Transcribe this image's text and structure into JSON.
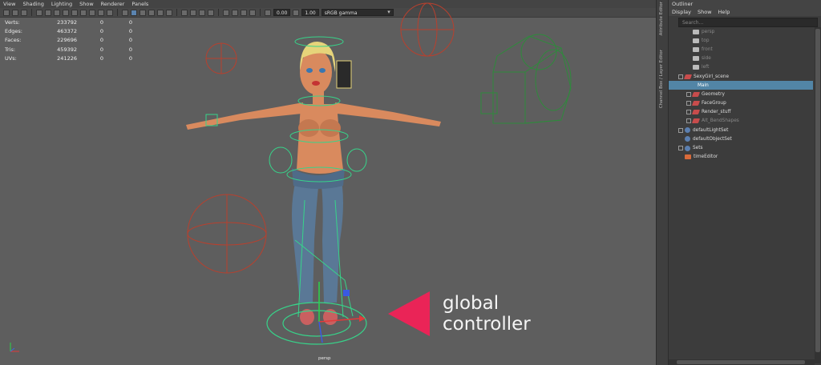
{
  "viewport": {
    "menu": [
      "View",
      "Shading",
      "Lighting",
      "Show",
      "Renderer",
      "Panels"
    ],
    "toolbar": {
      "exposure": "0.00",
      "gamma": "1.00",
      "color_space": "sRGB gamma"
    },
    "hud": [
      {
        "label": "Verts:",
        "values": [
          "233792",
          "0",
          "0"
        ]
      },
      {
        "label": "Edges:",
        "values": [
          "463372",
          "0",
          "0"
        ]
      },
      {
        "label": "Faces:",
        "values": [
          "229696",
          "0",
          "0"
        ]
      },
      {
        "label": "Tris:",
        "values": [
          "459392",
          "0",
          "0"
        ]
      },
      {
        "label": "UVs:",
        "values": [
          "241226",
          "0",
          "0"
        ]
      }
    ],
    "camera_label": "persp",
    "callout": {
      "line1": "global",
      "line2": "controller",
      "color": "#ea2457"
    }
  },
  "side_tabs": [
    "Attribute Editor",
    "Channel Box / Layer Editor"
  ],
  "outliner": {
    "title": "Outliner",
    "menu": [
      "Display",
      "Show",
      "Help"
    ],
    "search_placeholder": "Search...",
    "items": [
      {
        "label": "persp",
        "icon": "camera-icon",
        "level": 1,
        "expander": "",
        "dim": true
      },
      {
        "label": "top",
        "icon": "camera-icon",
        "level": 1,
        "expander": "",
        "dim": true
      },
      {
        "label": "front",
        "icon": "camera-icon",
        "level": 1,
        "expander": "",
        "dim": true
      },
      {
        "label": "side",
        "icon": "camera-icon",
        "level": 1,
        "expander": "",
        "dim": true
      },
      {
        "label": "left",
        "icon": "camera-icon",
        "level": 1,
        "expander": "",
        "dim": true
      },
      {
        "label": "SexyGirl_scene",
        "icon": "transform-icon",
        "level": 0,
        "expander": "-"
      },
      {
        "label": "Main",
        "icon": "",
        "level": 2,
        "expander": "",
        "selected": true
      },
      {
        "label": "Geometry",
        "icon": "transform-icon",
        "level": 1,
        "expander": "+"
      },
      {
        "label": "FaceGroup",
        "icon": "transform-icon",
        "level": 1,
        "expander": "+"
      },
      {
        "label": "Render_stuff",
        "icon": "transform-icon",
        "level": 1,
        "expander": "+"
      },
      {
        "label": "Alt_BendShapes",
        "icon": "transform-icon",
        "level": 1,
        "expander": "+",
        "dim": true
      },
      {
        "label": "defaultLightSet",
        "icon": "set-icon",
        "level": 0,
        "expander": "+"
      },
      {
        "label": "defaultObjectSet",
        "icon": "set-icon",
        "level": 0,
        "expander": ""
      },
      {
        "label": "Sets",
        "icon": "set-icon",
        "level": 0,
        "expander": "+"
      },
      {
        "label": "timeEditor",
        "icon": "time-icon",
        "level": 0,
        "expander": ""
      }
    ]
  }
}
